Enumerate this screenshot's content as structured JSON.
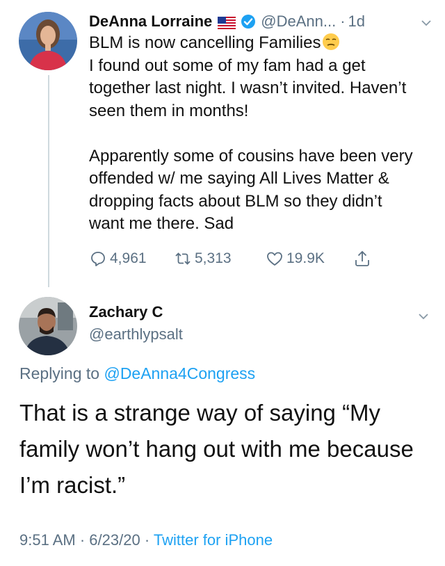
{
  "tweet1": {
    "author_name": "DeAnna Lorraine",
    "handle": "@DeAnn...",
    "separator": "·",
    "time": "1d",
    "flag_icon": "us-flag-icon",
    "verified_icon": "verified-badge-icon",
    "line1": "BLM is now cancelling Families",
    "body_rest": "I found out some of my fam had a get together last night. I wasn’t invited. Haven’t seen them in months!\n\nApparently some of cousins have been very offended w/ me saying All Lives Matter & dropping facts about BLM so they didn’t want me there. Sad",
    "emoji": "unamused-face-emoji",
    "replies": "4,961",
    "retweets": "5,313",
    "likes": "19.9K"
  },
  "tweet2": {
    "author_name": "Zachary C",
    "handle": "@earthlypsalt",
    "replying_prefix": "Replying to",
    "replying_to": "@DeAnna4Congress",
    "text": "That is a strange way of saying “My family won’t hang out with me because I’m racist.”",
    "time": "9:51 AM",
    "sep1": "·",
    "date": "6/23/20",
    "sep2": "·",
    "source": "Twitter for iPhone"
  },
  "colors": {
    "muted": "#5b7083",
    "link": "#1da1f2",
    "verified": "#1da1f2"
  }
}
